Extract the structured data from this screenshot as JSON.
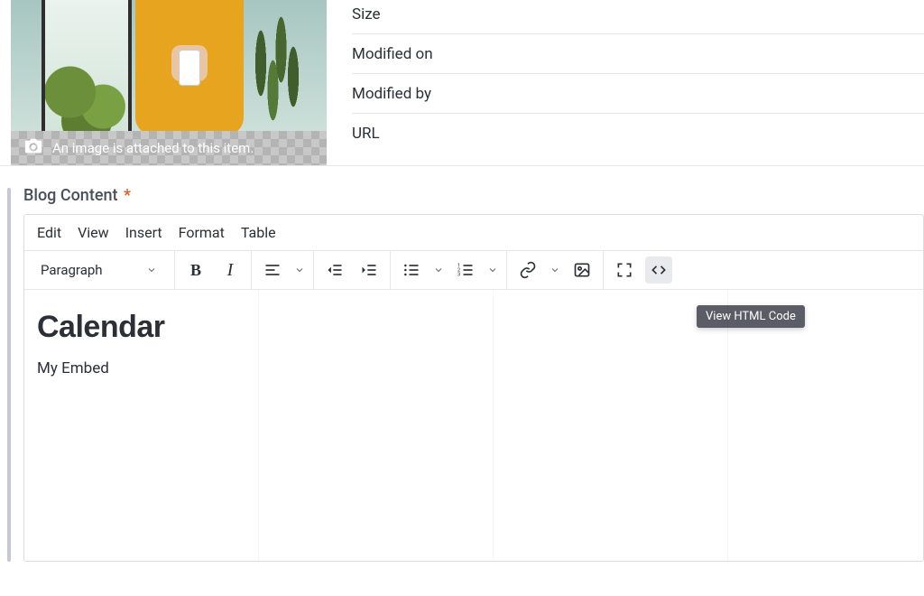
{
  "attachment": {
    "caption": "An image is attached to this item."
  },
  "meta": {
    "size_label": "Size",
    "modified_on_label": "Modified on",
    "modified_by_label": "Modified by",
    "url_label": "URL"
  },
  "section": {
    "title": "Blog Content",
    "required_marker": "*"
  },
  "menubar": {
    "edit": "Edit",
    "view": "View",
    "insert": "Insert",
    "format": "Format",
    "table": "Table"
  },
  "toolbar": {
    "block_select": "Paragraph",
    "tooltip_html": "View HTML Code"
  },
  "content": {
    "heading": "Calendar",
    "paragraph": "My Embed"
  }
}
